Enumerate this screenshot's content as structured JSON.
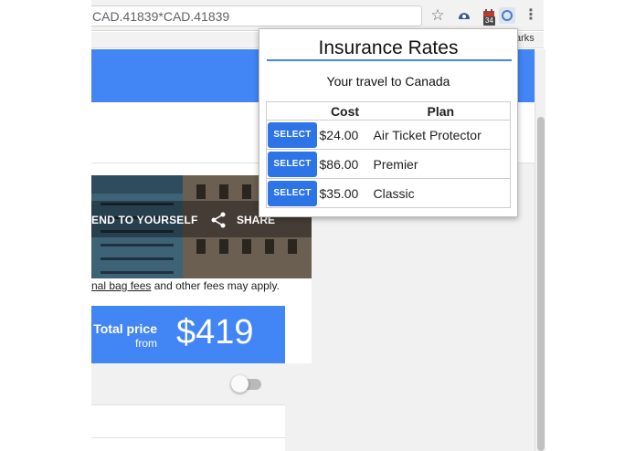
{
  "browser": {
    "url": "CAD.41839*CAD.41839",
    "icons": [
      "star-icon",
      "cloud-icon",
      "calendar-icon",
      "extension-icon",
      "menu-icon"
    ],
    "calendar_badge": "34",
    "bookmarks_text": "arks"
  },
  "page": {
    "send_text": "END TO YOURSELF",
    "share_text": "SHARE",
    "fees_link": "nal bag fees",
    "fees_rest": " and other fees may apply.",
    "total_label": "Total price",
    "from_label": "from",
    "price": "$419",
    "toggle_on": false
  },
  "popup": {
    "title": "Insurance Rates",
    "subtitle": "Your travel to Canada",
    "headers": {
      "cost": "Cost",
      "plan": "Plan"
    },
    "rows": [
      {
        "button": "SELECT",
        "cost": "$24.00",
        "plan": "Air Ticket Protector"
      },
      {
        "button": "SELECT",
        "cost": "$86.00",
        "plan": "Premier"
      },
      {
        "button": "SELECT",
        "cost": "$35.00",
        "plan": "Classic"
      }
    ]
  },
  "colors": {
    "accent": "#4285f4",
    "button": "#2d74e6"
  }
}
